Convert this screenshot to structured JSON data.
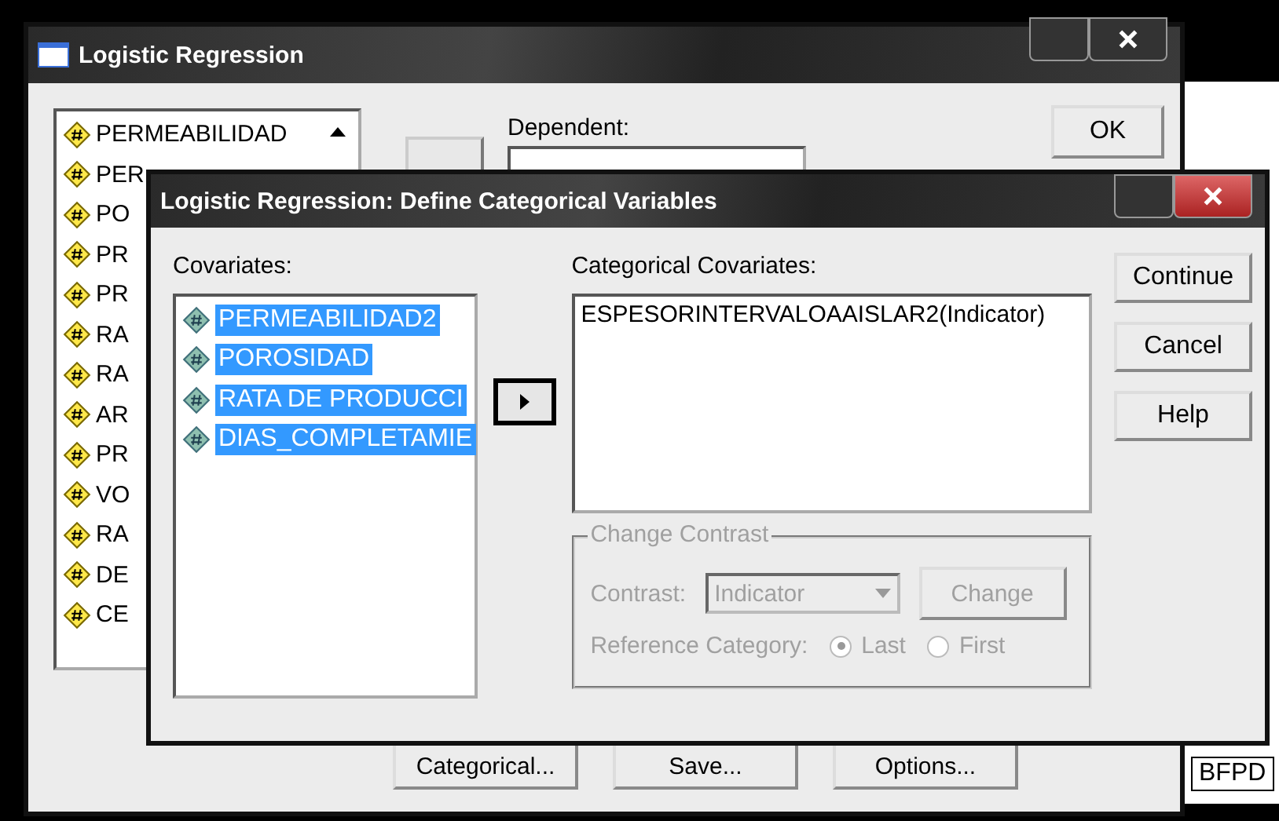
{
  "main_window": {
    "title": "Logistic Regression",
    "variables": [
      {
        "label": "PERMEABILIDAD"
      },
      {
        "label": "PER"
      },
      {
        "label": "PO"
      },
      {
        "label": "PR"
      },
      {
        "label": "PR"
      },
      {
        "label": "RA"
      },
      {
        "label": "RA"
      },
      {
        "label": "AR"
      },
      {
        "label": "PR"
      },
      {
        "label": "VO"
      },
      {
        "label": "RA"
      },
      {
        "label": "DE"
      },
      {
        "label": "CE"
      }
    ],
    "dependent_label": "Dependent:",
    "ok": "OK",
    "buttons": [
      "Categorical...",
      "Save...",
      "Options..."
    ]
  },
  "background_cell": "BFPD",
  "dialog": {
    "title": "Logistic Regression: Define Categorical Variables",
    "covariates_label": "Covariates:",
    "covariates": [
      {
        "label": "PERMEABILIDAD2",
        "selected": true
      },
      {
        "label": "POROSIDAD",
        "selected": true
      },
      {
        "label": "RATA DE PRODUCCI",
        "selected": true
      },
      {
        "label": "DIAS_COMPLETAMIE",
        "selected": true
      }
    ],
    "categorical_label": "Categorical Covariates:",
    "categorical": [
      "ESPESORINTERVALOAAISLAR2(Indicator)"
    ],
    "group_title": "Change Contrast",
    "contrast_label": "Contrast:",
    "contrast_value": "Indicator",
    "change": "Change",
    "reference_label": "Reference Category:",
    "reference_options": [
      {
        "label": "Last",
        "selected": true
      },
      {
        "label": "First",
        "selected": false
      }
    ],
    "contrast_disabled": true,
    "buttons": [
      "Continue",
      "Cancel",
      "Help"
    ]
  }
}
